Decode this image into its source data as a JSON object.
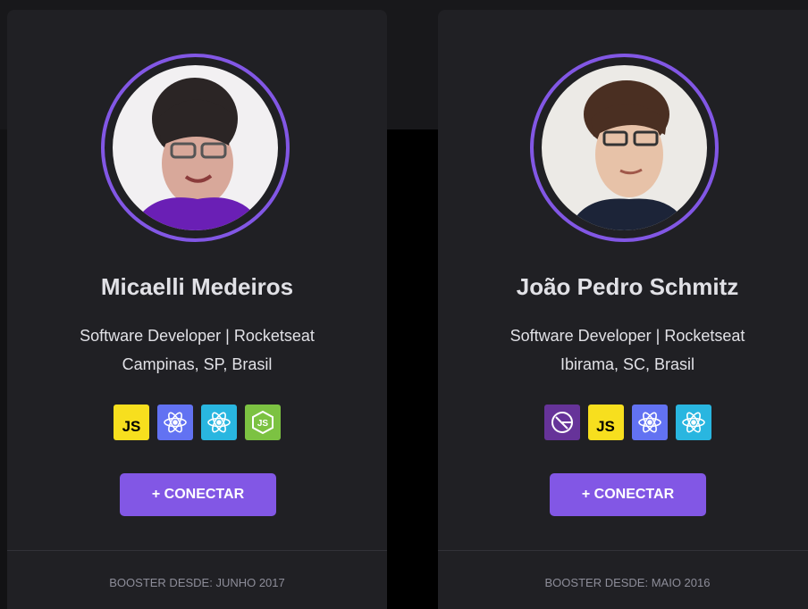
{
  "colors": {
    "accent": "#8257e5",
    "card_bg": "#202024",
    "text": "#e1e1e6",
    "muted": "#8d8d99"
  },
  "cards": [
    {
      "name": "Micaelli Medeiros",
      "role": "Software Developer | Rocketseat",
      "location": "Campinas, SP, Brasil",
      "badges": [
        {
          "icon": "javascript-icon",
          "label": "JS",
          "color": "#f7df1e"
        },
        {
          "icon": "react-icon",
          "color": "#6272f2"
        },
        {
          "icon": "react-icon",
          "color": "#29b6e0"
        },
        {
          "icon": "nodejs-icon",
          "label": "JS",
          "color": "#7cc242"
        }
      ],
      "connect_label": "+ CONECTAR",
      "footer": "BOOSTER DESDE: JUNHO 2017"
    },
    {
      "name": "João Pedro Schmitz",
      "role": "Software Developer | Rocketseat",
      "location": "Ibirama, SC, Brasil",
      "badges": [
        {
          "icon": "gatsby-icon",
          "color": "#663399"
        },
        {
          "icon": "javascript-icon",
          "label": "JS",
          "color": "#f7df1e"
        },
        {
          "icon": "react-icon",
          "color": "#6272f2"
        },
        {
          "icon": "react-icon",
          "color": "#29b6e0"
        }
      ],
      "connect_label": "+ CONECTAR",
      "footer": "BOOSTER DESDE: MAIO 2016"
    }
  ]
}
